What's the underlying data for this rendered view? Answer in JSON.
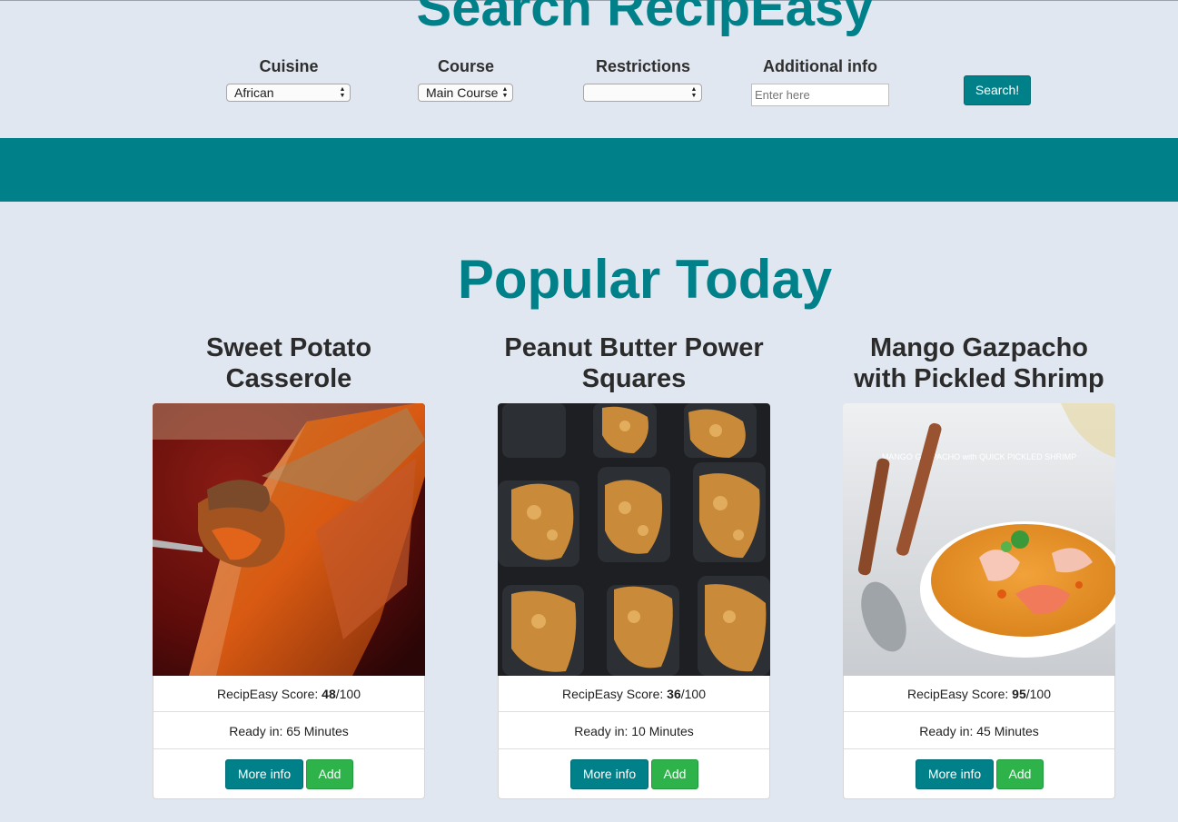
{
  "header": {
    "title": "Search RecipEasy"
  },
  "search": {
    "cuisine": {
      "label": "Cuisine",
      "value": "African"
    },
    "course": {
      "label": "Course",
      "value": "Main Course"
    },
    "restrictions": {
      "label": "Restrictions",
      "value": ""
    },
    "additional": {
      "label": "Additional info",
      "placeholder": "Enter here"
    },
    "button_label": "Search!"
  },
  "popular": {
    "title": "Popular Today",
    "cards": [
      {
        "title_line1": "Sweet Potato",
        "title_line2": "Casserole",
        "score_label": "RecipEasy Score: ",
        "score": "48",
        "score_max": "/100",
        "ready": "Ready in: 65 Minutes",
        "more_label": "More info",
        "add_label": "Add"
      },
      {
        "title_line1": "Peanut Butter Power",
        "title_line2": "Squares",
        "score_label": "RecipEasy Score: ",
        "score": "36",
        "score_max": "/100",
        "ready": "Ready in: 10 Minutes",
        "more_label": "More info",
        "add_label": "Add"
      },
      {
        "title_line1": "Mango Gazpacho",
        "title_line2": "with Pickled Shrimp",
        "score_label": "RecipEasy Score: ",
        "score": "95",
        "score_max": "/100",
        "ready": "Ready in: 45 Minutes",
        "more_label": "More info",
        "add_label": "Add",
        "image_caption": "MANGO GAZPACHO with QUICK PICKLED SHRIMP"
      }
    ]
  },
  "colors": {
    "brand": "#008089",
    "add": "#2db34a",
    "background": "#e1e7f0"
  }
}
